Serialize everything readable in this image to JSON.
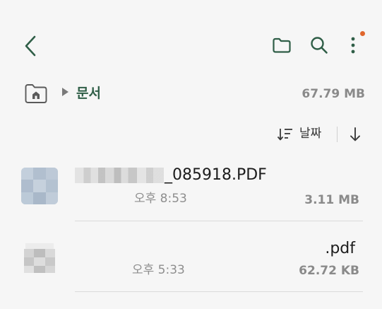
{
  "colors": {
    "accent_green": "#2f5e47",
    "notification_dot": "#e0672d",
    "muted_text": "#8a8a8a"
  },
  "appbar": {
    "back_icon": "chevron-left-icon",
    "folder_icon": "folder-icon",
    "search_icon": "search-icon",
    "more_icon": "more-vertical-icon",
    "has_notification_dot": true
  },
  "breadcrumb": {
    "home_icon": "home-folder-icon",
    "separator_icon": "triangle-right-icon",
    "current_folder": "문서",
    "storage_used": "67.79 MB"
  },
  "sort": {
    "icon": "sort-icon",
    "label": "날짜",
    "direction_icon": "arrow-down-icon"
  },
  "files": [
    {
      "name_visible": "_085918.PDF",
      "name_redacted": true,
      "time": "오후 8:53",
      "size": "3.11 MB"
    },
    {
      "name_visible": ".pdf",
      "name_redacted": false,
      "time": "오후 5:33",
      "size": "62.72 KB"
    }
  ]
}
